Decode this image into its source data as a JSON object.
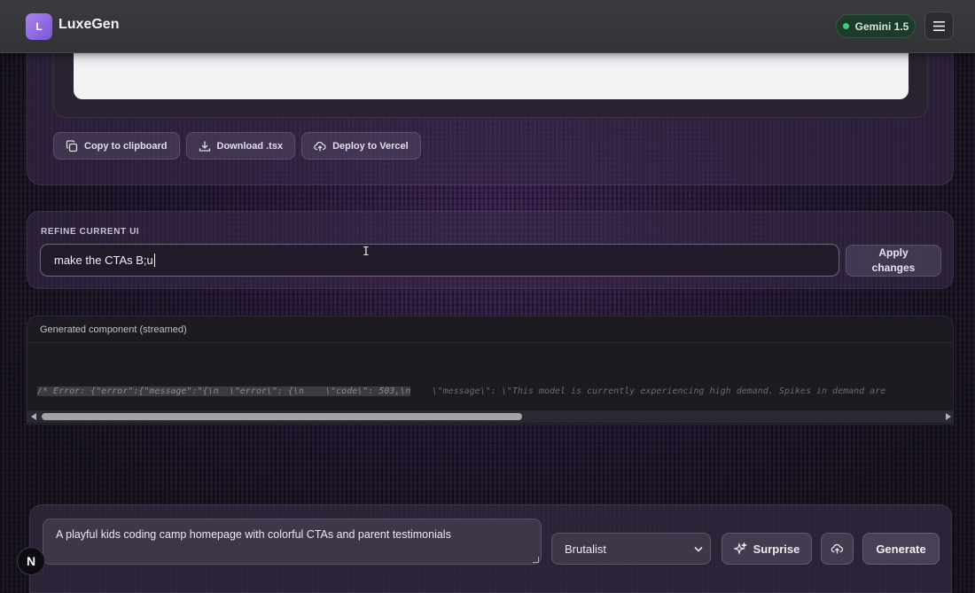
{
  "header": {
    "logo_letter": "L",
    "brand": "LuxeGen",
    "model_badge": "Gemini 1.5",
    "menu_icon": "hamburger-icon"
  },
  "preview": {
    "actions": [
      {
        "label": "Copy to clipboard",
        "icon": "copy-icon"
      },
      {
        "label": "Download .tsx",
        "icon": "download-icon"
      },
      {
        "label": "Deploy to Vercel",
        "icon": "cloud-upload-icon"
      }
    ]
  },
  "refine": {
    "label": "REFINE CURRENT UI",
    "input_value": "make the CTAs B;u",
    "apply_label_line1": "Apply",
    "apply_label_line2": "changes"
  },
  "stream": {
    "title": "Generated component (streamed)",
    "code_highlighted": "/* Error: {\"error\":{\"message\":\"{\\n  \\\"error\\\": {\\n    \\\"code\\\": 503,\\n",
    "code_rest": "    \\\"message\\\": \\\"This model is currently experiencing high demand. Spikes in demand are"
  },
  "composer": {
    "prompt_value": "A playful kids coding camp homepage with colorful CTAs and parent testimonials",
    "style_selected": "Brutalist",
    "surprise_label": "Surprise",
    "generate_label": "Generate"
  },
  "overlay": {
    "next_badge_letter": "N"
  },
  "colors": {
    "accent_purple": "#8b63e0",
    "status_green": "#3ecf73"
  }
}
